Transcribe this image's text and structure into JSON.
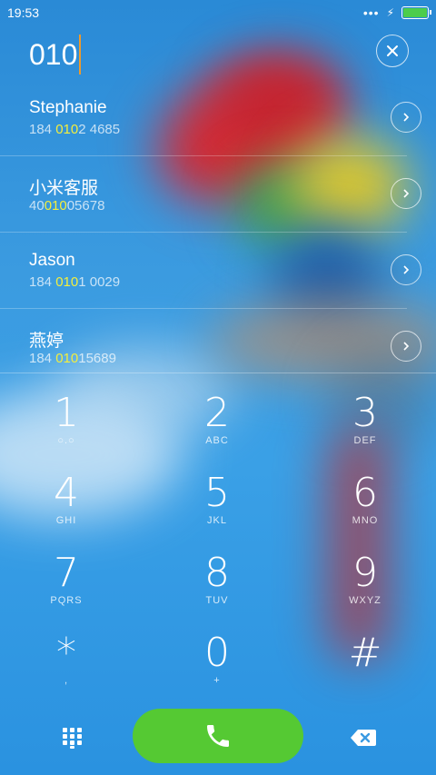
{
  "status": {
    "time": "19:53",
    "signal_dots": "•••",
    "charging": "⚡"
  },
  "input": {
    "number": "010"
  },
  "contacts": [
    {
      "name": "Stephanie",
      "number_pre": "184 ",
      "number_hl": "010",
      "number_post": "2 4685"
    },
    {
      "name": "小米客服",
      "number_pre": "40",
      "number_hl": "010",
      "number_post": "05678"
    },
    {
      "name": "Jason",
      "number_pre": "184 ",
      "number_hl": "010",
      "number_post": "1 0029"
    },
    {
      "name": "燕婷",
      "number_pre": "184 ",
      "number_hl": "010",
      "number_post": "15689"
    }
  ],
  "keypad": [
    {
      "digit": "1",
      "letters": "○.○"
    },
    {
      "digit": "2",
      "letters": "ABC"
    },
    {
      "digit": "3",
      "letters": "DEF"
    },
    {
      "digit": "4",
      "letters": "GHI"
    },
    {
      "digit": "5",
      "letters": "JKL"
    },
    {
      "digit": "6",
      "letters": "MNO"
    },
    {
      "digit": "7",
      "letters": "PQRS"
    },
    {
      "digit": "8",
      "letters": "TUV"
    },
    {
      "digit": "9",
      "letters": "WXYZ"
    },
    {
      "digit": "*",
      "letters": ","
    },
    {
      "digit": "0",
      "letters": "+"
    },
    {
      "digit": "#",
      "letters": ""
    }
  ],
  "colors": {
    "call_green": "#55c933",
    "highlight": "#f4ee3c",
    "cursor": "#f09a2a",
    "battery": "#4ccd4c"
  },
  "icons": {
    "clear": "close-icon",
    "contact_arrow": "chevron-right-icon",
    "dialpad": "dialpad-grid-icon",
    "call": "phone-icon",
    "delete": "backspace-icon"
  }
}
